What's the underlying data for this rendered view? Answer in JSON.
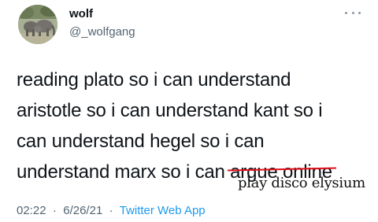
{
  "author": {
    "name": "wolf",
    "handle": "@_wolfgang",
    "avatar_icon": "elephant-photo-avatar"
  },
  "tweet": {
    "lines": [
      "reading plato so i can understand",
      "aristotle so i can understand kant so i",
      "can understand hegel so i can"
    ],
    "last_line_prefix": "understand marx so i can ",
    "struck_text": "argue online",
    "handwritten_replacement": "play disco elysium"
  },
  "meta": {
    "time": "02:22",
    "date": "6/26/21",
    "source": "Twitter Web App",
    "separator": "·"
  },
  "colors": {
    "text": "#0f1419",
    "secondary": "#536471",
    "link": "#1d9bf0",
    "strike": "#e0101a"
  },
  "icons": {
    "more": "more-dots-icon"
  }
}
